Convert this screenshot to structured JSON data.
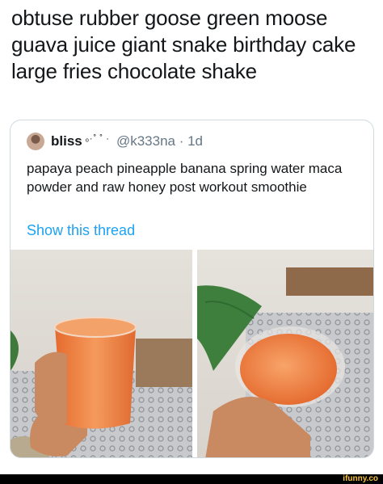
{
  "post": {
    "text": "obtuse rubber goose green moose\nguava juice giant snake birthday cake\nlarge fries chocolate shake"
  },
  "quote": {
    "display_name": "bliss",
    "name_decoration": "ₒ·˚ ˚ ·",
    "handle_time": "@k333na · 1d",
    "text": "papaya peach pineapple banana spring water maca powder and raw honey post workout smoothie",
    "show_thread": "Show this thread"
  },
  "footer": {
    "watermark": "ifunny.co"
  },
  "colors": {
    "link": "#1da1f2",
    "muted": "#657786",
    "border": "#cfd9de",
    "smoothie": "#f0803c"
  }
}
